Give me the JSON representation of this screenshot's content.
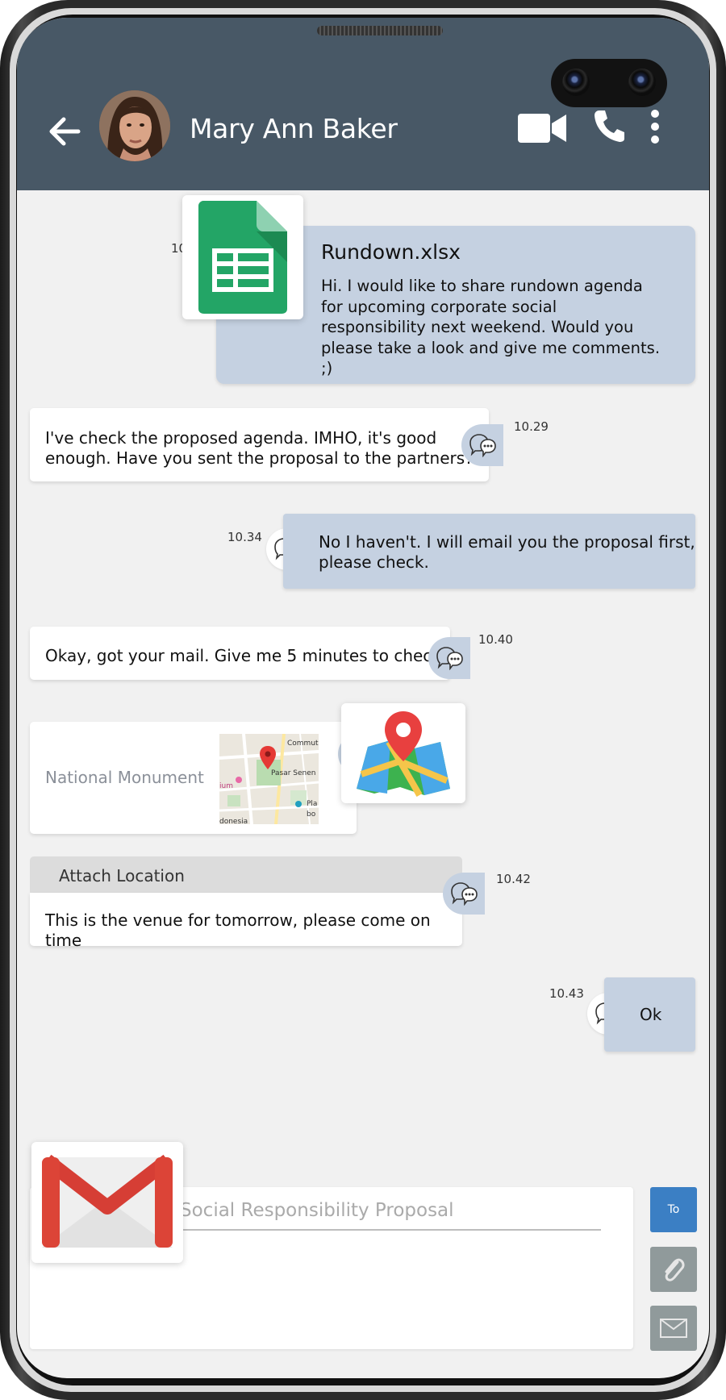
{
  "header": {
    "contact_name": "Mary Ann Baker",
    "icons": [
      "back-arrow-icon",
      "video-call-icon",
      "phone-call-icon",
      "more-vert-icon"
    ],
    "bg_color": "#485866"
  },
  "messages": {
    "file_msg": {
      "timestamp": "10",
      "file_name": "Rundown.xlsx",
      "text": "Hi. I would like to share rundown agenda for upcoming corporate social responsibility next weekend. Would you please take a look and give me comments. ;)"
    },
    "msg2": {
      "text_line1": "I've check the proposed agenda. IMHO, it's good",
      "text_line2": "enough. Have you sent the proposal to the partners?",
      "timestamp": "10.29"
    },
    "msg3": {
      "text_line1": "No I haven't. I will email you the proposal first,",
      "text_line2": "please check.",
      "timestamp": "10.34"
    },
    "msg4": {
      "text": "Okay, got your mail. Give me 5 minutes to check",
      "timestamp": "10.40"
    },
    "location_card": {
      "place": "National Monument",
      "map_labels": [
        "Commuter",
        "Pasar Senen",
        "ium",
        "Pla",
        "donesia",
        "bo"
      ]
    },
    "msg5": {
      "header": "Attach Location",
      "text": "This is the venue for tomorrow, please come on time",
      "timestamp": "10.42"
    },
    "msg6": {
      "text": "Ok",
      "timestamp": "10.43"
    }
  },
  "compose": {
    "subject_value": "Social Responsibility Proposal",
    "to_label": "To",
    "icons": [
      "gmail-icon",
      "attach-icon",
      "send-mail-icon"
    ]
  },
  "colors": {
    "out_bubble": "#c5d1e1",
    "in_bubble": "#ffffff",
    "to_button": "#3b7fc4",
    "gray_button": "#909a9b"
  }
}
